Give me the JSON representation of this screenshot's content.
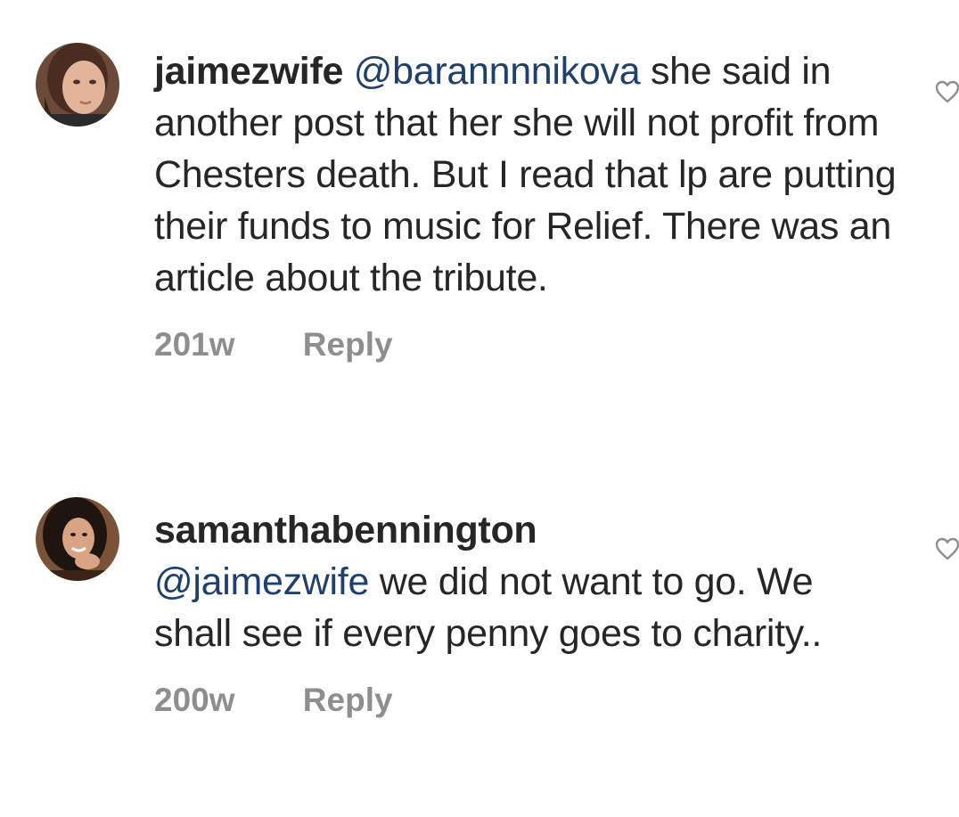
{
  "comments": [
    {
      "username": "jaimezwife",
      "mention": "@barannnnikova",
      "text": " she said in another post that her she will not profit from Chesters death. But I read that lp are putting their funds to music for Relief. There was an article about the tribute.",
      "time": "201w",
      "reply_label": "Reply",
      "like_icon": "heart-outline-icon"
    },
    {
      "username": "samanthabennington",
      "mention": "@jaimezwife",
      "text": " we did not want to go. We shall see if every penny goes to charity..",
      "time": "200w",
      "reply_label": "Reply",
      "like_icon": "heart-outline-icon"
    }
  ],
  "colors": {
    "text": "#262626",
    "mention": "#1f3f6e",
    "meta": "#8e8e8e"
  }
}
